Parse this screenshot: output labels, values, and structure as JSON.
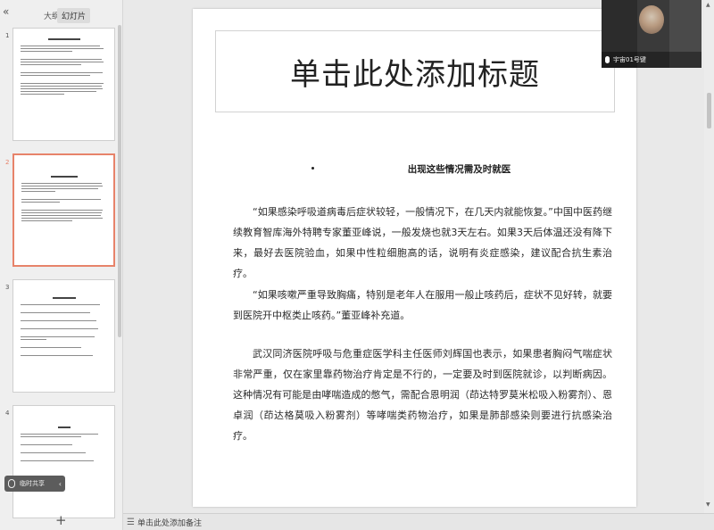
{
  "left_pane": {
    "collapse_icon": "«",
    "tabs": [
      {
        "label": "大纲"
      },
      {
        "label": "幻灯片",
        "active": true
      }
    ],
    "thumbnails": [
      {
        "number": "1"
      },
      {
        "number": "2",
        "selected": true
      },
      {
        "number": "3"
      },
      {
        "number": "4"
      }
    ],
    "add_icon": "+",
    "speaker": {
      "label": "临时共享",
      "chevron": "‹"
    }
  },
  "video": {
    "name": "宇宙01号键"
  },
  "slide": {
    "title": "单击此处添加标题",
    "heading": "出现这些情况需及时就医",
    "paragraphs": [
      "“如果感染呼吸道病毒后症状较轻，一般情况下，在几天内就能恢复。”中国中医药继续教育智库海外特聘专家董亚峰说，一般发烧也就3天左右。如果3天后体温还没有降下来，最好去医院验血，如果中性粒细胞高的话，说明有炎症感染，建议配合抗生素治疗。",
      "“如果咳嗽严重导致胸痛，特别是老年人在服用一般止咳药后，症状不见好转，就要到医院开中枢类止咳药。”董亚峰补充道。",
      "武汉同济医院呼吸与危重症医学科主任医师刘辉国也表示，如果患者胸闷气喘症状非常严重，仅在家里靠药物治疗肯定是不行的，一定要及时到医院就诊，以判断病因。这种情况有可能是由哮喘造成的憋气，需配合恩明润（茚达特罗莫米松吸入粉雾剂）、恩卓润（茚达格莫吸入粉雾剂）等哮喘类药物治疗，如果是肺部感染则要进行抗感染治疗。"
    ]
  },
  "notes": {
    "placeholder": "单击此处添加备注"
  },
  "colors": {
    "selected_thumb_border": "#e7836a",
    "canvas_bg": "#e9e9e9"
  }
}
